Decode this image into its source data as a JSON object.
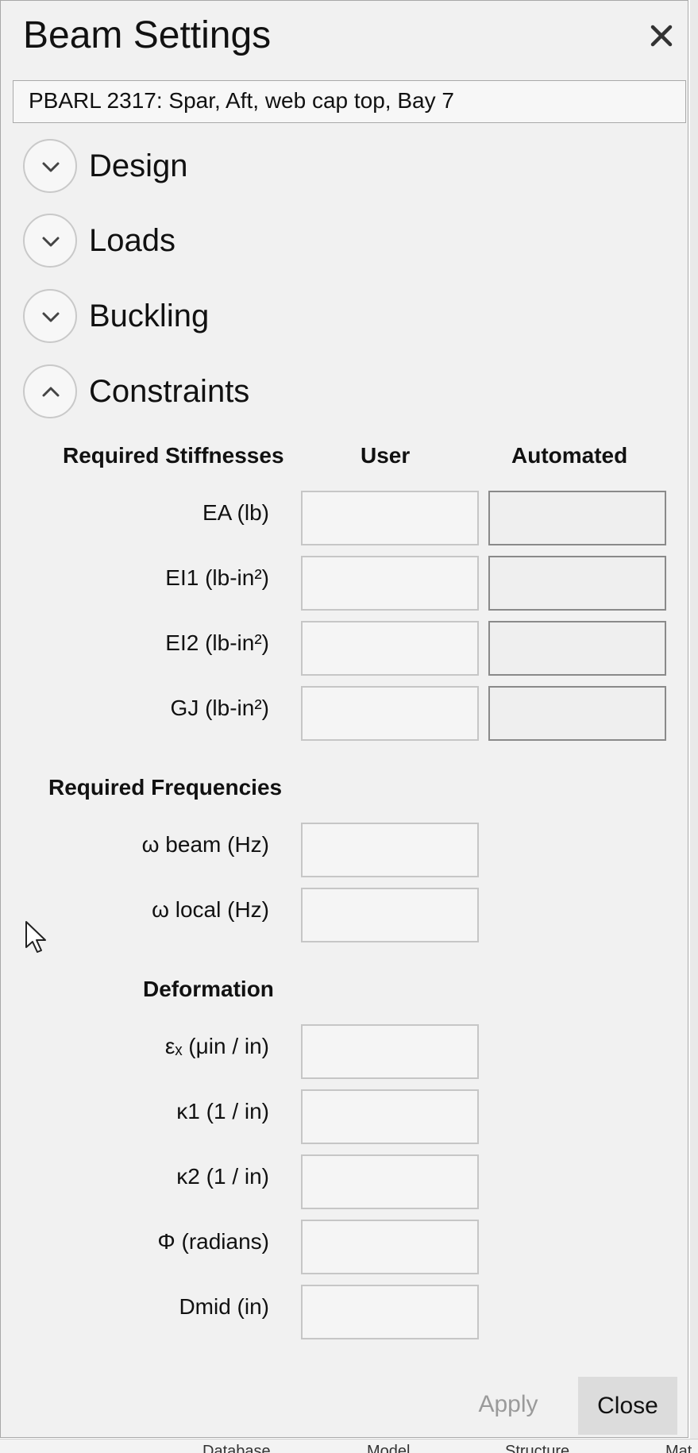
{
  "backdrop": {
    "tabs": [
      "Database",
      "Model",
      "Structure",
      "Mat"
    ]
  },
  "dialog": {
    "title": "Beam Settings",
    "name_value": "PBARL 2317: Spar, Aft, web cap top, Bay 7",
    "sections": [
      {
        "label": "Design",
        "expanded": false
      },
      {
        "label": "Loads",
        "expanded": false
      },
      {
        "label": "Buckling",
        "expanded": false
      },
      {
        "label": "Constraints",
        "expanded": true
      }
    ],
    "constraints": {
      "stiffness_header": "Required Stiffnesses",
      "col_user": "User",
      "col_automated": "Automated",
      "stiffnesses": [
        {
          "label": "EA (lb)",
          "user": "",
          "automated": ""
        },
        {
          "label": "EI1 (lb-in²)",
          "user": "",
          "automated": ""
        },
        {
          "label": "EI2 (lb-in²)",
          "user": "",
          "automated": ""
        },
        {
          "label": "GJ (lb-in²)",
          "user": "",
          "automated": ""
        }
      ],
      "frequency_header": "Required Frequencies",
      "frequencies": [
        {
          "label": "ω beam (Hz)",
          "user": ""
        },
        {
          "label": "ω local (Hz)",
          "user": ""
        }
      ],
      "deformation_header": "Deformation",
      "deformations": [
        {
          "label": "εₓ (μin / in)",
          "user": ""
        },
        {
          "label": "κ1 (1 / in)",
          "user": ""
        },
        {
          "label": "κ2 (1 / in)",
          "user": ""
        },
        {
          "label": "Φ (radians)",
          "user": ""
        },
        {
          "label": "Dmid (in)",
          "user": ""
        }
      ]
    },
    "buttons": {
      "apply": "Apply",
      "close": "Close"
    }
  }
}
